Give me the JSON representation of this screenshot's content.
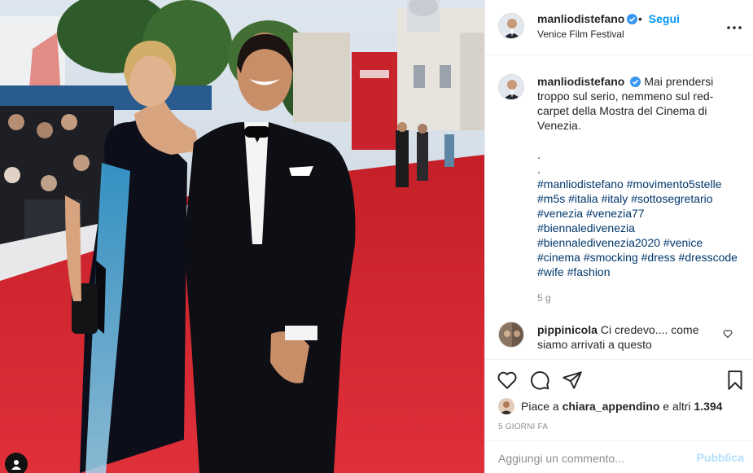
{
  "post": {
    "username": "manliodistefano",
    "follow_separator": "•",
    "follow_label": "Segui",
    "location": "Venice Film Festival",
    "icons": {
      "verified": "verified-badge-icon",
      "more": "more-options-icon",
      "user_tag": "user-tag-icon"
    }
  },
  "caption": {
    "username": "manliodistefano",
    "text": "Mai prendersi troppo sul serio, nemmeno sul red-carpet della Mostra del Cinema di Venezia.\n\n.\n.",
    "hashtags": [
      "#manliodistefano",
      "#movimento5stelle",
      "#m5s",
      "#italia",
      "#italy",
      "#sottosegretario",
      "#venezia",
      "#venezia77",
      "#biennaledivenezia",
      "#biennaledivenezia2020",
      "#venice",
      "#cinema",
      "#smocking",
      "#dress",
      "#dresscode",
      "#wife",
      "#fashion"
    ],
    "time": "5 g"
  },
  "comment": {
    "username": "pippinicola",
    "text": "Ci credevo.... come siamo arrivati a questo"
  },
  "actions": {
    "icons": [
      "like-heart-icon",
      "comment-icon",
      "share-icon",
      "save-bookmark-icon"
    ]
  },
  "likes": {
    "prefix": "Piace a",
    "user": "chiara_appendino",
    "suffix": "e altri",
    "count": "1.394"
  },
  "date": "5 GIORNI FA",
  "add_comment": {
    "placeholder": "Aggiungi un commento...",
    "publish_label": "Pubblica"
  },
  "colors": {
    "link": "#0095f6",
    "hashtag": "#00376b",
    "verified": "#3897f0",
    "carpet": "#d0252c"
  }
}
